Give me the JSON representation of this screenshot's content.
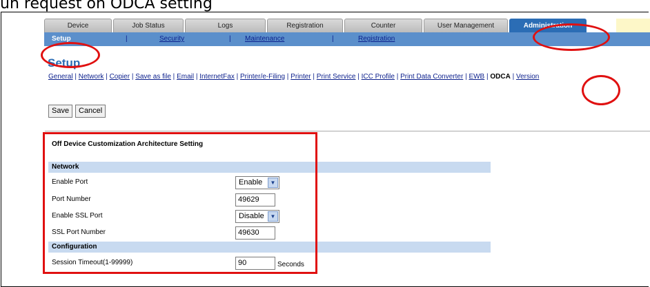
{
  "caption": "un request on ODCA setting",
  "tabs": [
    "Device",
    "Job Status",
    "Logs",
    "Registration",
    "Counter",
    "User Management",
    "Administration"
  ],
  "subnav": {
    "active": "Setup",
    "sep": "|",
    "security": "Security",
    "maintenance": "Maintenance",
    "registration": "Registration"
  },
  "page_title": "Setup",
  "setup_links": [
    "General",
    "Network",
    "Copier",
    "Save as file",
    "Email",
    "InternetFax",
    "Printer/e-Filing",
    "Printer",
    "Print Service",
    "ICC Profile",
    "Print Data Converter",
    "EWB",
    "ODCA",
    "Version"
  ],
  "buttons": {
    "save": "Save",
    "cancel": "Cancel"
  },
  "settings": {
    "title": "Off Device Customization Architecture Setting",
    "network_header": "Network",
    "enable_port_label": "Enable Port",
    "enable_port_value": "Enable",
    "port_number_label": "Port Number",
    "port_number_value": "49629",
    "enable_ssl_label": "Enable SSL Port",
    "enable_ssl_value": "Disable",
    "ssl_port_label": "SSL Port Number",
    "ssl_port_value": "49630",
    "config_header": "Configuration",
    "timeout_label": "Session Timeout(1-99999)",
    "timeout_value": "90",
    "timeout_unit": "Seconds"
  },
  "colors": {
    "accent": "#2b6db5",
    "highlight": "#e01010",
    "subnav": "#5b8fcb",
    "section_bar": "#c8daf0"
  }
}
